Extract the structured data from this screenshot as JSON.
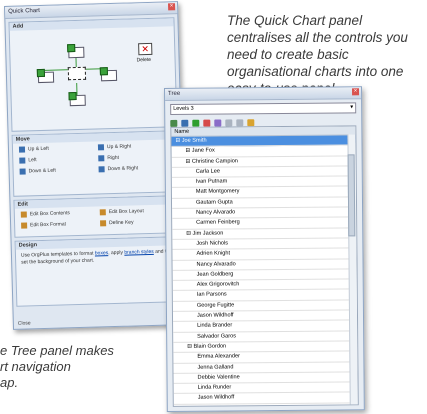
{
  "captions": {
    "quick_chart": "The Quick Chart panel centralises all the controls you need to create basic organisational charts into one easy-to-use panel.",
    "tree": "e Tree panel makes\nrt navigation\nap."
  },
  "quick_chart_panel": {
    "title": "Quick Chart",
    "add_section": "Add",
    "delete_label": "Delete",
    "move_section": "Move",
    "move_commands": [
      "Up & Left",
      "Up & Right",
      "Left",
      "Right",
      "Down & Left",
      "Down & Right"
    ],
    "edit_section": "Edit",
    "edit_commands": [
      "Edit Box Contents",
      "Edit Box Layout",
      "Edit Box Format",
      "Define Key"
    ],
    "design_section": "Design",
    "design_text_before": "Use OrgPlus templates to format ",
    "design_link_boxes": "boxes",
    "design_text_mid": ", apply ",
    "design_link_branch": "branch styles",
    "design_text_after": " and to set the background of your chart.",
    "footer": "Close"
  },
  "tree_panel": {
    "title": "Tree",
    "level_select": "Levels 3",
    "name_header": "Name",
    "rows": [
      {
        "name": "Joe Smith",
        "level": 0,
        "selected": true
      },
      {
        "name": "Jane Fox",
        "level": 1
      },
      {
        "name": "Christine Campion",
        "level": 1
      },
      {
        "name": "Carla Lee",
        "level": 2
      },
      {
        "name": "Ivan Putnam",
        "level": 2
      },
      {
        "name": "Matt Montgomery",
        "level": 2
      },
      {
        "name": "Gautam Gupta",
        "level": 2
      },
      {
        "name": "Nancy Alvarado",
        "level": 2
      },
      {
        "name": "Carmen Feinberg",
        "level": 2
      },
      {
        "name": "Jim Jackson",
        "level": 1
      },
      {
        "name": "Josh Nichols",
        "level": 2
      },
      {
        "name": "Adrien Knight",
        "level": 2
      },
      {
        "name": "Nancy Alvarado",
        "level": 2
      },
      {
        "name": "Jean Goldberg",
        "level": 2
      },
      {
        "name": "Alex Grigorovitch",
        "level": 2
      },
      {
        "name": "Ian Parsons",
        "level": 2
      },
      {
        "name": "George Fugitte",
        "level": 2
      },
      {
        "name": "Jason Wildhoff",
        "level": 2
      },
      {
        "name": "Linda Brander",
        "level": 2
      },
      {
        "name": "Salvador Garos",
        "level": 2
      },
      {
        "name": "Blain Gordon",
        "level": 1
      },
      {
        "name": "Emma Alexander",
        "level": 2
      },
      {
        "name": "Jenna Galland",
        "level": 2
      },
      {
        "name": "Debbie Valentine",
        "level": 2
      },
      {
        "name": "Linda Runder",
        "level": 2
      },
      {
        "name": "Jason Wildhoff",
        "level": 2
      }
    ]
  }
}
